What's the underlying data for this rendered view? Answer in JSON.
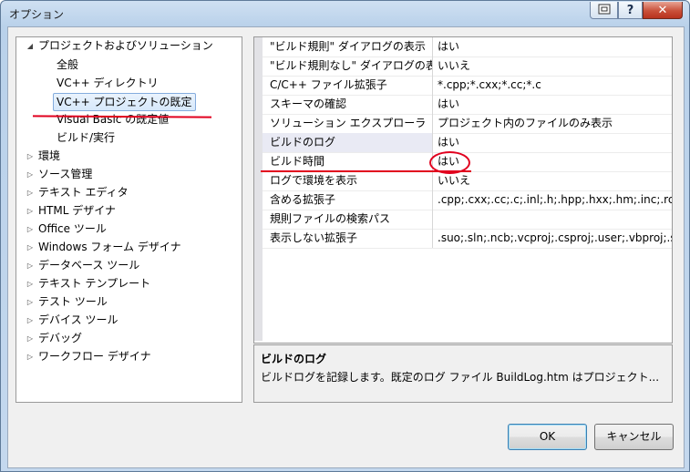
{
  "window": {
    "title": "オプション"
  },
  "titlebar": {
    "help_glyph": "?",
    "close_glyph": "✕"
  },
  "tree": {
    "items": [
      {
        "label": "プロジェクトおよびソリューション",
        "expanded": true
      },
      {
        "label": "全般"
      },
      {
        "label": "VC++ ディレクトリ"
      },
      {
        "label": "VC++ プロジェクトの既定",
        "selected": true
      },
      {
        "label": "Visual Basic の既定値"
      },
      {
        "label": "ビルド/実行"
      },
      {
        "label": "環境"
      },
      {
        "label": "ソース管理"
      },
      {
        "label": "テキスト エディタ"
      },
      {
        "label": "HTML デザイナ"
      },
      {
        "label": "Office ツール"
      },
      {
        "label": "Windows フォーム デザイナ"
      },
      {
        "label": "データベース ツール"
      },
      {
        "label": "テキスト テンプレート"
      },
      {
        "label": "テスト ツール"
      },
      {
        "label": "デバイス ツール"
      },
      {
        "label": "デバッグ"
      },
      {
        "label": "ワークフロー デザイナ"
      }
    ]
  },
  "properties": [
    {
      "name": "\"ビルド規則\" ダイアログの表示",
      "value": "はい"
    },
    {
      "name": "\"ビルド規則なし\" ダイアログの表示",
      "value": "いいえ"
    },
    {
      "name": "C/C++ ファイル拡張子",
      "value": "*.cpp;*.cxx;*.cc;*.c"
    },
    {
      "name": "スキーマの確認",
      "value": "はい"
    },
    {
      "name": "ソリューション エクスプローラ",
      "value": "プロジェクト内のファイルのみ表示"
    },
    {
      "name": "ビルドのログ",
      "value": "はい",
      "highlighted": true
    },
    {
      "name": "ビルド時間",
      "value": "はい"
    },
    {
      "name": "ログで環境を表示",
      "value": "いいえ"
    },
    {
      "name": "含める拡張子",
      "value": ".cpp;.cxx;.cc;.c;.inl;.h;.hpp;.hxx;.hm;.inc;.rc"
    },
    {
      "name": "規則ファイルの検索パス",
      "value": ""
    },
    {
      "name": "表示しない拡張子",
      "value": ".suo;.sln;.ncb;.vcproj;.csproj;.user;.vbproj;.s"
    }
  ],
  "description": {
    "title": "ビルドのログ",
    "text": "ビルドログを記録します。既定のログ ファイル BuildLog.htm はプロジェクト..."
  },
  "buttons": {
    "ok": "OK",
    "cancel": "キャンセル"
  },
  "annotation_color": "#e1001e"
}
